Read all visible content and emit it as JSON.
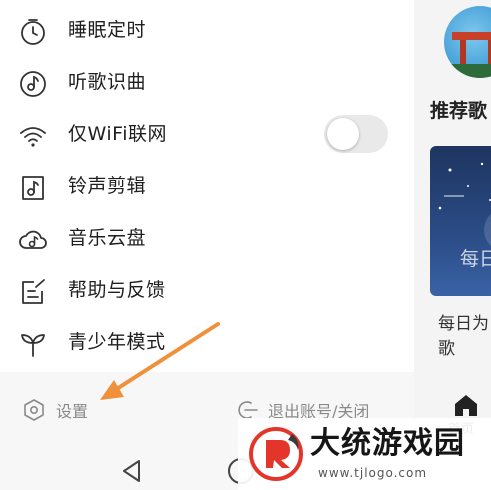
{
  "drawer": {
    "items": [
      {
        "label": "睡眠定时",
        "icon": "timer-icon"
      },
      {
        "label": "听歌识曲",
        "icon": "music-recognize-icon"
      },
      {
        "label": "仅WiFi联网",
        "icon": "wifi-icon",
        "toggle": false
      },
      {
        "label": "铃声剪辑",
        "icon": "ringtone-icon"
      },
      {
        "label": "音乐云盘",
        "icon": "cloud-icon"
      },
      {
        "label": "帮助与反馈",
        "icon": "feedback-icon"
      },
      {
        "label": "青少年模式",
        "icon": "sprout-icon"
      }
    ],
    "footer": {
      "settings_label": "设置",
      "logout_label": "退出账号/关闭"
    }
  },
  "main": {
    "section_title": "推荐歌",
    "card_overlay_text": "每日",
    "card_caption": "每日为歌",
    "tab_home_label": "首页"
  },
  "watermark": {
    "text": "大统游戏园",
    "domain": "www.tjlogo.com"
  },
  "colors": {
    "annotation_arrow": "#f0903a",
    "toggle_off": "#e9e9ea",
    "footer_bg": "#f7f7f7"
  }
}
